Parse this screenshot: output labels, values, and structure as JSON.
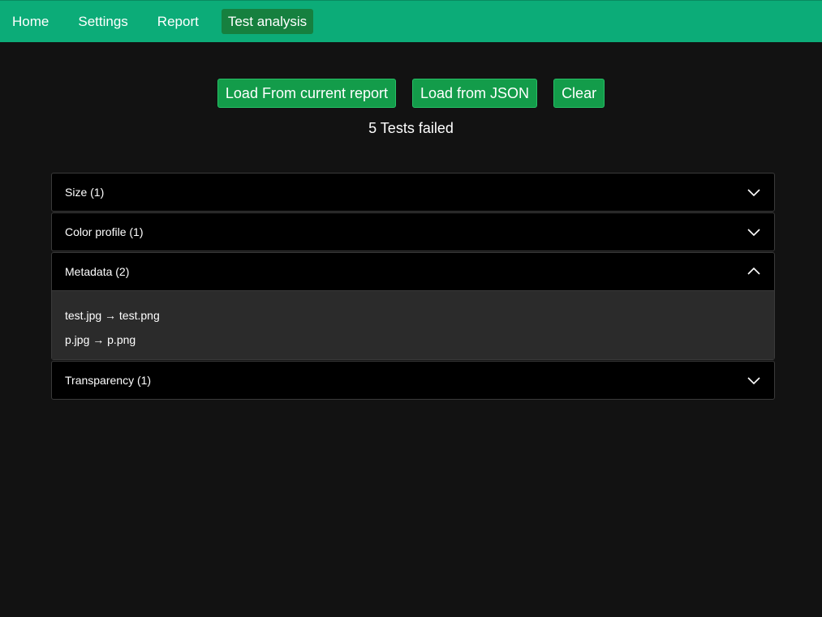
{
  "nav": {
    "items": [
      {
        "label": "Home"
      },
      {
        "label": "Settings"
      },
      {
        "label": "Report"
      },
      {
        "label": "Test analysis",
        "active": true
      }
    ]
  },
  "actions": {
    "load_current": "Load From current report",
    "load_json": "Load from JSON",
    "clear": "Clear"
  },
  "status": "5 Tests failed",
  "groups": [
    {
      "title": "Size (1)",
      "expanded": false,
      "icon": "chevron-down-icon"
    },
    {
      "title": "Color profile (1)",
      "expanded": false,
      "icon": "chevron-down-icon"
    },
    {
      "title": "Metadata (2)",
      "expanded": true,
      "icon": "chevron-up-icon",
      "items": [
        "test.jpg → test.png",
        "p.jpg → p.png"
      ]
    },
    {
      "title": "Transparency (1)",
      "expanded": false,
      "icon": "chevron-down-icon"
    }
  ],
  "colors": {
    "navbar": "#0cac78",
    "active_tab": "#16803f",
    "button": "#139c4a",
    "background": "#121212",
    "panel": "#000000",
    "panel_body": "#2b2b2b"
  }
}
